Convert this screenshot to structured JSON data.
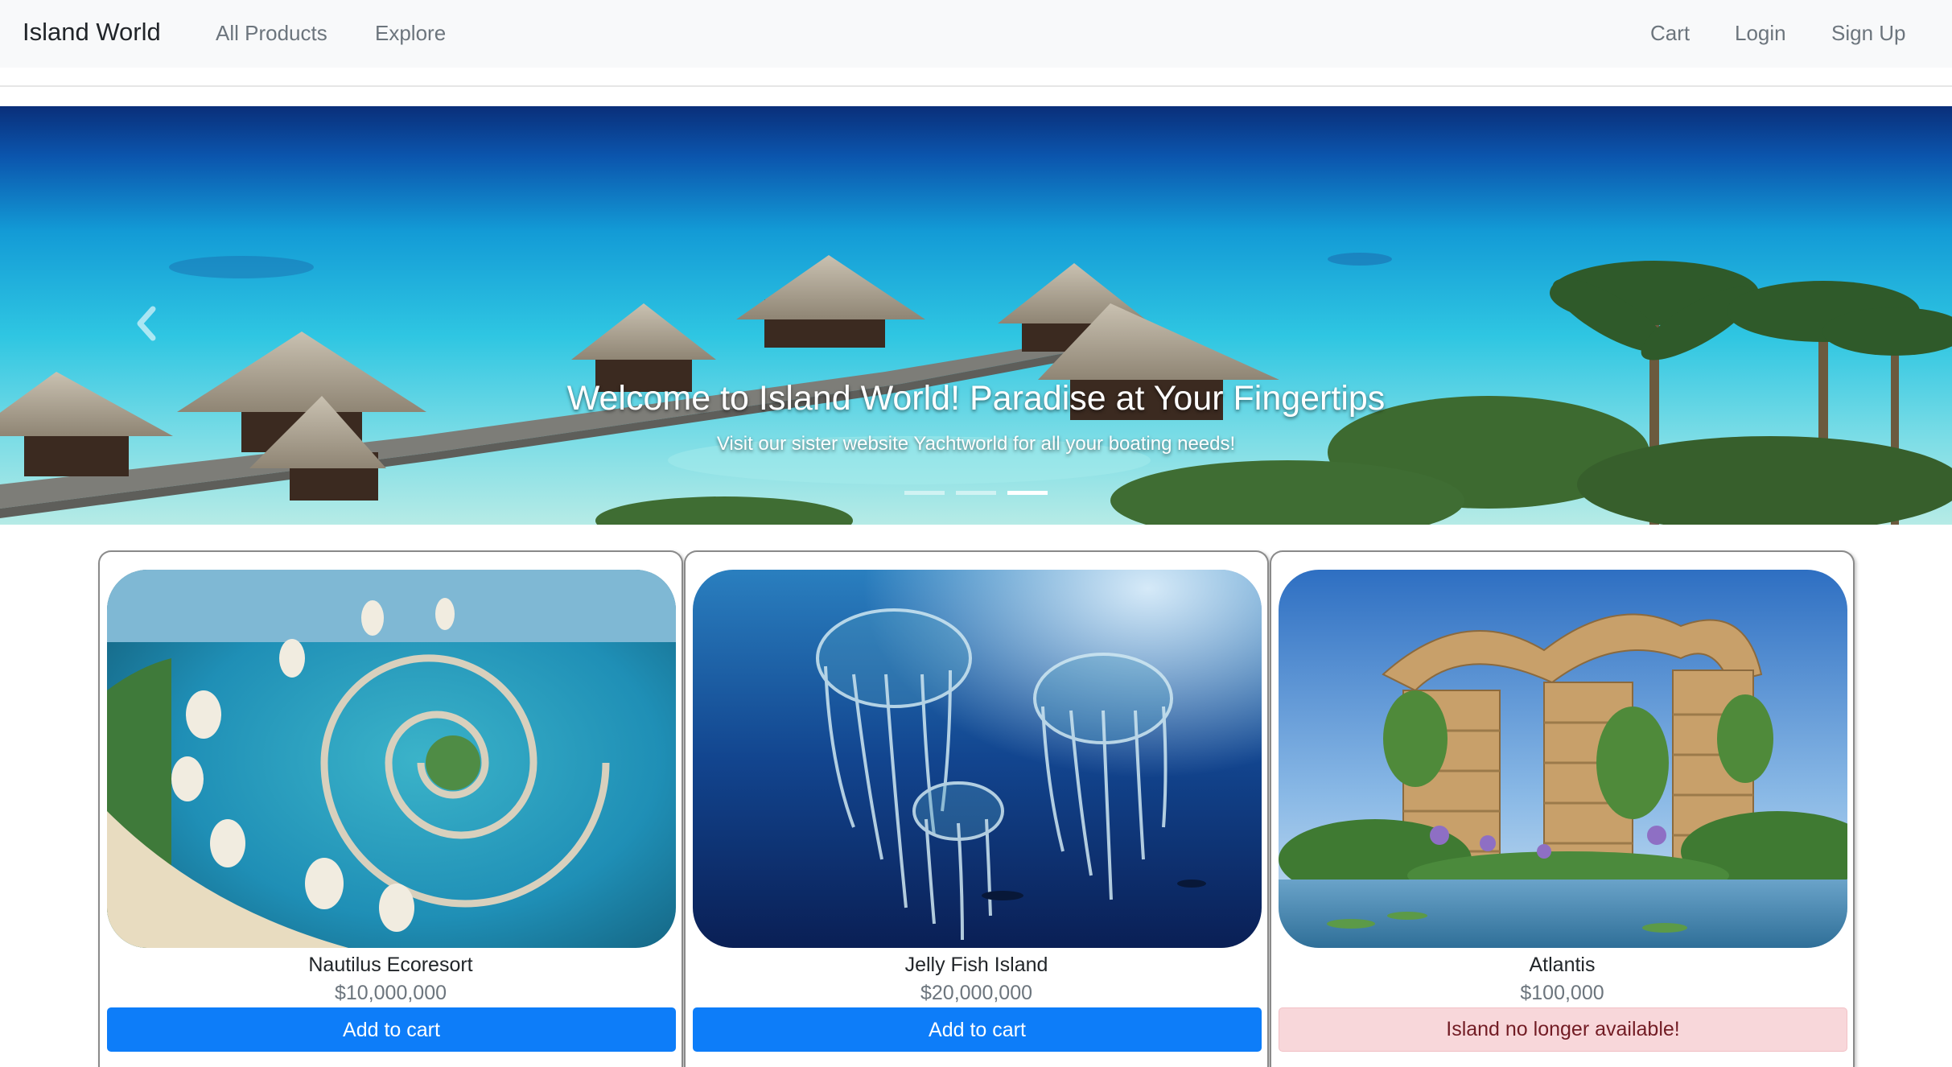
{
  "navbar": {
    "brand": "Island World",
    "links": [
      "All Products",
      "Explore"
    ],
    "right_links": [
      "Cart",
      "Login",
      "Sign Up"
    ]
  },
  "carousel": {
    "title": "Welcome to Island World! Paradise at Your Fingertips",
    "subtitle": "Visit our sister website Yachtworld for all your boating needs!",
    "slide_count": 3,
    "active_slide": 3
  },
  "products": [
    {
      "name": "Nautilus Ecoresort",
      "price": "$10,000,000",
      "action": "Add to cart",
      "image": "spiral-resort-island"
    },
    {
      "name": "Jelly Fish Island",
      "price": "$20,000,000",
      "action": "Add to cart",
      "image": "jellyfish-underwater"
    },
    {
      "name": "Atlantis",
      "price": "$100,000",
      "status": "Island no longer available!",
      "image": "vertical-garden-towers"
    }
  ],
  "colors": {
    "primary": "#0d7df9",
    "danger_bg": "#f8d7da",
    "danger_text": "#721c24",
    "navbar_bg": "#f8f9fa"
  }
}
